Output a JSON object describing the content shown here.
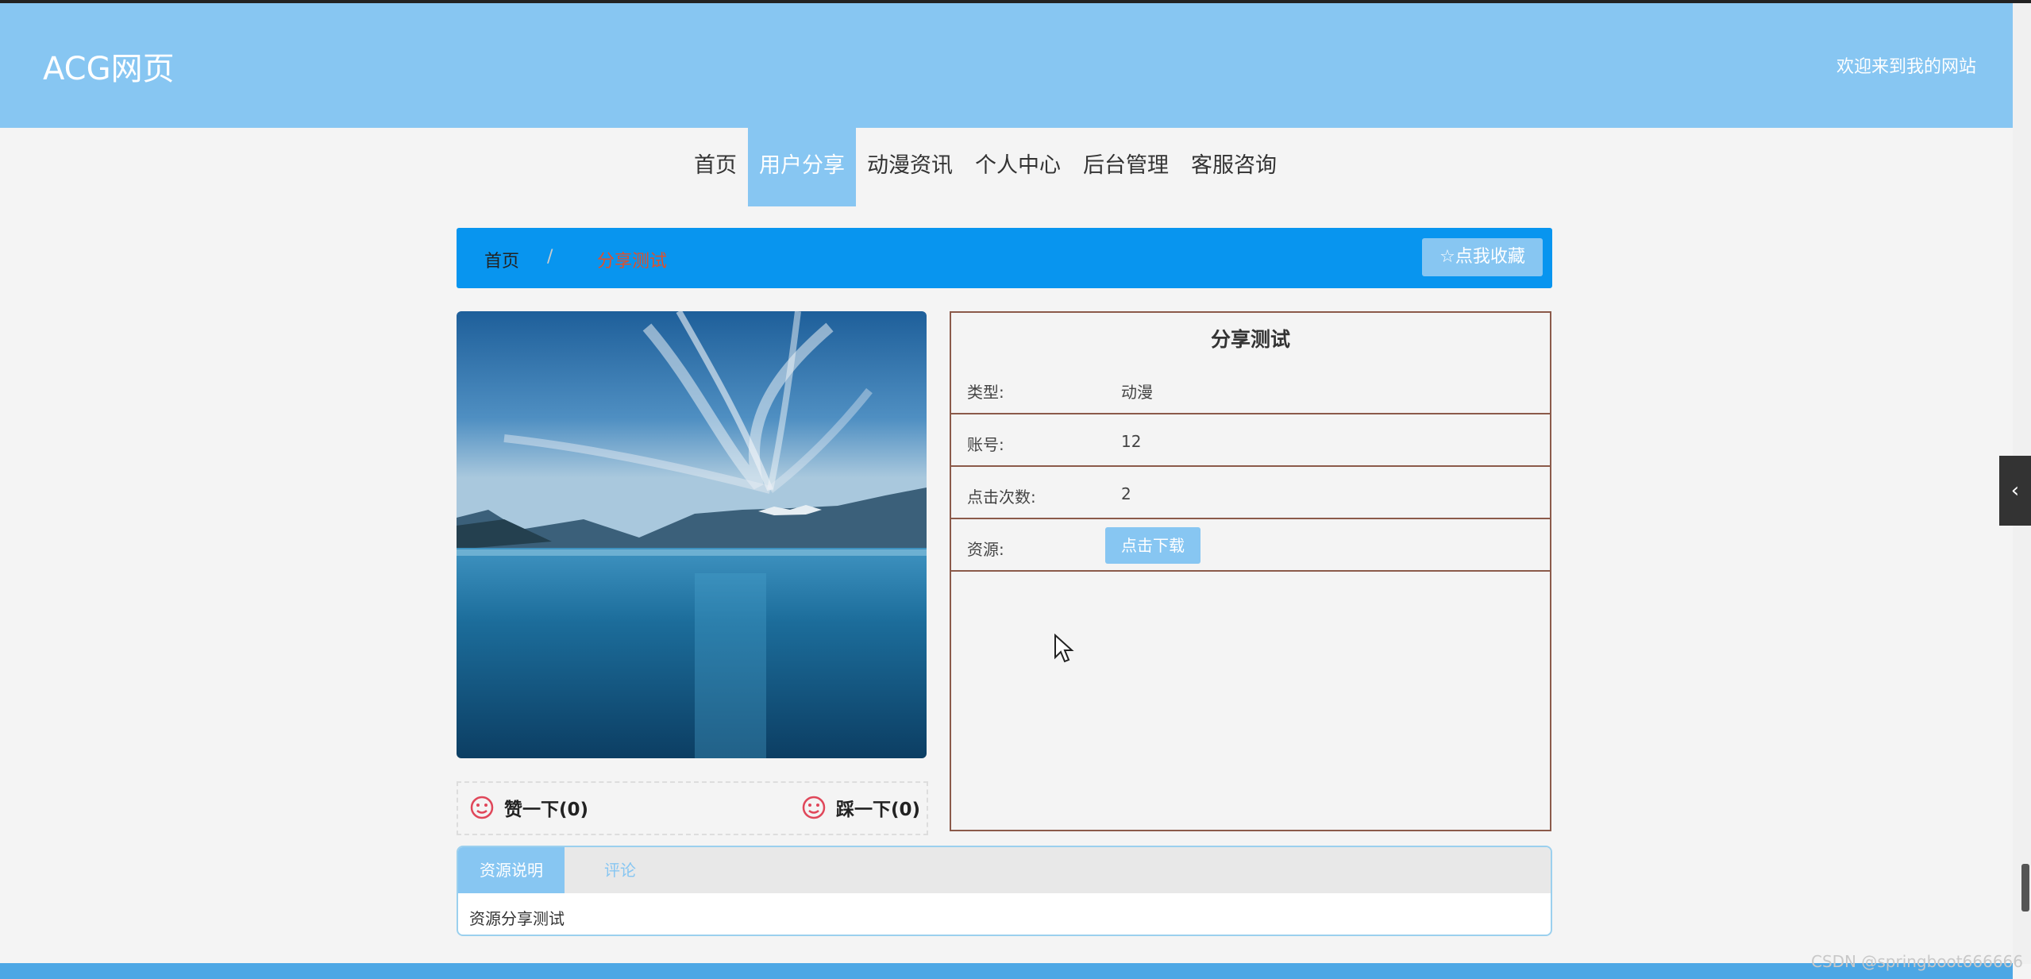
{
  "header": {
    "logo": "ACG网页",
    "welcome": "欢迎来到我的网站"
  },
  "nav": {
    "items": [
      {
        "label": "首页",
        "active": false
      },
      {
        "label": "用户分享",
        "active": true
      },
      {
        "label": "动漫资讯",
        "active": false
      },
      {
        "label": "个人中心",
        "active": false
      },
      {
        "label": "后台管理",
        "active": false
      },
      {
        "label": "客服咨询",
        "active": false
      }
    ]
  },
  "breadcrumb": {
    "home": "首页",
    "separator": "/",
    "current": "分享测试",
    "favorite_label": "☆点我收藏"
  },
  "detail": {
    "title": "分享测试",
    "type_label": "类型:",
    "type_value": "动漫",
    "account_label": "账号:",
    "account_value": "12",
    "clicks_label": "点击次数:",
    "clicks_value": "2",
    "resource_label": "资源:",
    "download_label": "点击下载"
  },
  "votes": {
    "like_label": "赞一下(0)",
    "dislike_label": "踩一下(0)"
  },
  "tabs": {
    "items": [
      {
        "label": "资源说明",
        "active": true
      },
      {
        "label": "评论",
        "active": false
      }
    ],
    "content": "资源分享测试"
  },
  "watermark": "CSDN @springboot666666",
  "colors": {
    "header": "#87c6f2",
    "breadcrumb_bar": "#0895ef",
    "accent": "#87c6f2",
    "info_border": "#8b5a4a",
    "face_icon": "#e0475a"
  },
  "icons": {
    "like": "smile-face-icon",
    "dislike": "smile-face-icon",
    "side_toggle": "chevron-left-icon"
  }
}
